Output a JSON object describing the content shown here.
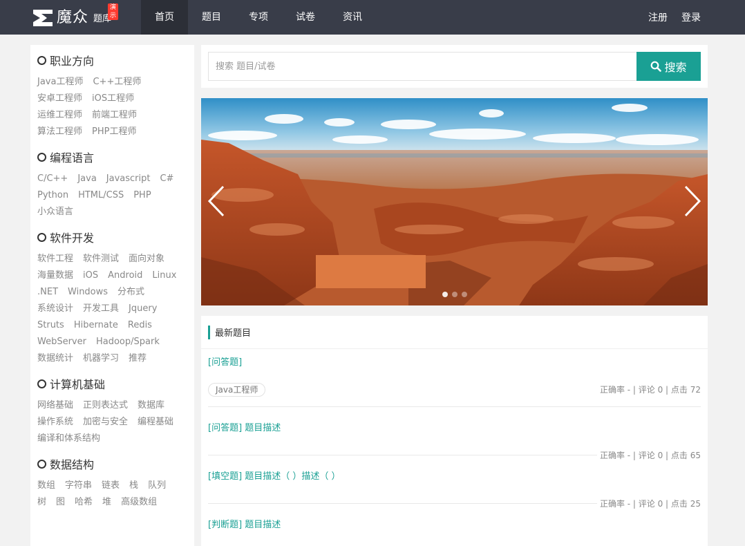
{
  "header": {
    "logo_name": "魔众",
    "logo_sub": "题库",
    "logo_badge": "演示",
    "nav": [
      {
        "label": "首页",
        "active": true
      },
      {
        "label": "题目",
        "active": false
      },
      {
        "label": "专项",
        "active": false
      },
      {
        "label": "试卷",
        "active": false
      },
      {
        "label": "资讯",
        "active": false
      }
    ],
    "register": "注册",
    "login": "登录"
  },
  "sidebar": {
    "categories": [
      {
        "title": "职业方向",
        "tags": [
          "Java工程师",
          "C++工程师",
          "安卓工程师",
          "iOS工程师",
          "运维工程师",
          "前端工程师",
          "算法工程师",
          "PHP工程师"
        ]
      },
      {
        "title": "编程语言",
        "tags": [
          "C/C++",
          "Java",
          "Javascript",
          "C#",
          "Python",
          "HTML/CSS",
          "PHP",
          "小众语言"
        ]
      },
      {
        "title": "软件开发",
        "tags": [
          "软件工程",
          "软件测试",
          "面向对象",
          "海量数据",
          "iOS",
          "Android",
          "Linux",
          ".NET",
          "Windows",
          "分布式",
          "系统设计",
          "开发工具",
          "Jquery",
          "Struts",
          "Hibernate",
          "Redis",
          "WebServer",
          "Hadoop/Spark",
          "数据统计",
          "机器学习",
          "推荐"
        ]
      },
      {
        "title": "计算机基础",
        "tags": [
          "网络基础",
          "正则表达式",
          "数据库",
          "操作系统",
          "加密与安全",
          "编程基础",
          "编译和体系结构"
        ]
      },
      {
        "title": "数据结构",
        "tags": [
          "数组",
          "字符串",
          "链表",
          "栈",
          "队列",
          "树",
          "图",
          "哈希",
          "堆",
          "高级数组"
        ]
      }
    ]
  },
  "search": {
    "placeholder": "搜索 题目/试卷",
    "button": "搜索"
  },
  "carousel": {
    "slide_count": 3,
    "active_index": 0
  },
  "latest": {
    "heading": "最新题目",
    "items": [
      {
        "title": "[问答题]",
        "tag": "Java工程师",
        "stats": "正确率 - | 评论 0 | 点击 72"
      },
      {
        "title": "[问答题] 题目描述",
        "tag": "",
        "stats": "正确率 - | 评论 0 | 点击 65"
      },
      {
        "title": "[填空题] 题目描述（ ）描述（ ）",
        "tag": "",
        "stats": "正确率 - | 评论 0 | 点击 25"
      },
      {
        "title": "[判断题] 题目描述",
        "tag": "",
        "stats": ""
      }
    ]
  },
  "colors": {
    "accent": "#1aa094",
    "header_bg": "#393d49",
    "caption_box": "#dd7a42"
  }
}
